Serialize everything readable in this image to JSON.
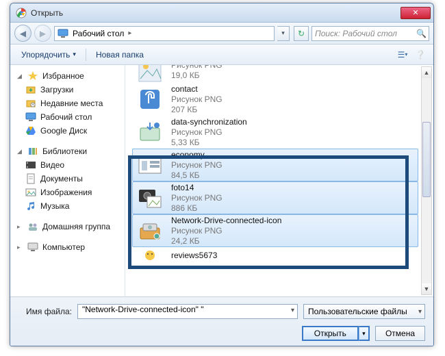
{
  "title": "Открыть",
  "nav": {
    "location": "Рабочий стол"
  },
  "search": {
    "placeholder": "Поиск: Рабочий стол"
  },
  "toolbar": {
    "organize": "Упорядочить",
    "newfolder": "Новая папка"
  },
  "sidebar": {
    "favorites": {
      "label": "Избранное",
      "items": [
        "Загрузки",
        "Недавние места",
        "Рабочий стол",
        "Google Диск"
      ]
    },
    "libraries": {
      "label": "Библиотеки",
      "items": [
        "Видео",
        "Документы",
        "Изображения",
        "Музыка"
      ]
    },
    "homegroup": {
      "label": "Домашняя группа"
    },
    "computer": {
      "label": "Компьютер"
    }
  },
  "files": [
    {
      "name": "",
      "type": "Рисунок PNG",
      "size": "19,0 КБ",
      "selected": false,
      "partial_top": true
    },
    {
      "name": "contact",
      "type": "Рисунок PNG",
      "size": "207 КБ",
      "selected": false
    },
    {
      "name": "data-synchronization",
      "type": "Рисунок PNG",
      "size": "5,33 КБ",
      "selected": false
    },
    {
      "name": "economy",
      "type": "Рисунок PNG",
      "size": "84,5 КБ",
      "selected": true
    },
    {
      "name": "foto14",
      "type": "Рисунок PNG",
      "size": "886 КБ",
      "selected": true
    },
    {
      "name": "Network-Drive-connected-icon",
      "type": "Рисунок PNG",
      "size": "24,2 КБ",
      "selected": true
    },
    {
      "name": "reviews5673",
      "type": "",
      "size": "",
      "selected": false,
      "partial_bottom": true
    }
  ],
  "footer": {
    "filename_label": "Имя файла:",
    "filename_value": "\"Network-Drive-connected-icon\" \"",
    "filter": "Пользовательские файлы",
    "open": "Открыть",
    "cancel": "Отмена"
  }
}
